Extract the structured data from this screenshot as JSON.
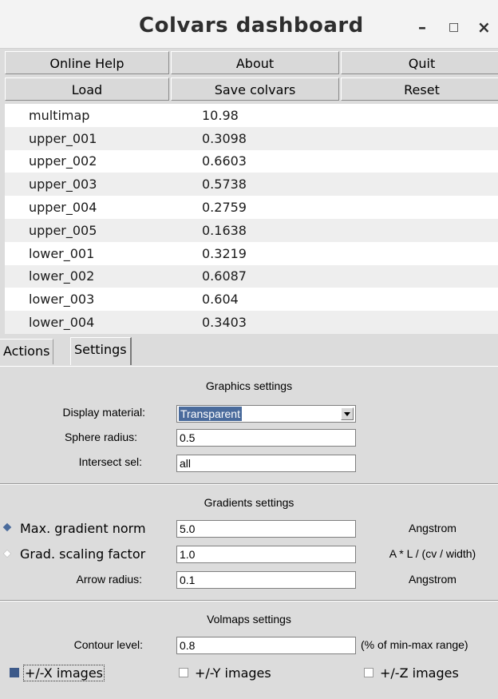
{
  "window": {
    "title": "Colvars dashboard",
    "minimize": "–",
    "maximize": "□",
    "close": "×"
  },
  "buttons": {
    "row1": [
      "Online Help",
      "About",
      "Quit"
    ],
    "row2": [
      "Load",
      "Save colvars",
      "Reset"
    ]
  },
  "colvars": [
    {
      "name": "multimap",
      "value": "10.98"
    },
    {
      "name": "upper_001",
      "value": "0.3098"
    },
    {
      "name": "upper_002",
      "value": "0.6603"
    },
    {
      "name": "upper_003",
      "value": "0.5738"
    },
    {
      "name": "upper_004",
      "value": "0.2759"
    },
    {
      "name": "upper_005",
      "value": "0.1638"
    },
    {
      "name": "lower_001",
      "value": "0.3219"
    },
    {
      "name": "lower_002",
      "value": "0.6087"
    },
    {
      "name": "lower_003",
      "value": "0.604"
    },
    {
      "name": "lower_004",
      "value": "0.3403"
    }
  ],
  "tabs": {
    "actions": "Actions",
    "settings": "Settings",
    "active": "Settings"
  },
  "graphics": {
    "title": "Graphics settings",
    "material_label": "Display material:",
    "material_value": "Transparent",
    "sphere_label": "Sphere radius:",
    "sphere_value": "0.5",
    "intersect_label": "Intersect sel:",
    "intersect_value": "all"
  },
  "gradients": {
    "title": "Gradients settings",
    "maxnorm_label": "Max. gradient norm",
    "maxnorm_value": "5.0",
    "maxnorm_unit": "Angstrom",
    "scaling_label": "Grad. scaling factor",
    "scaling_value": "1.0",
    "scaling_unit": "A * L / (cv / width)",
    "arrow_label": "Arrow radius:",
    "arrow_value": "0.1",
    "arrow_unit": "Angstrom",
    "selected_mode": "Max. gradient norm"
  },
  "volmaps": {
    "title": "Volmaps settings",
    "contour_label": "Contour level:",
    "contour_value": "0.8",
    "contour_unit": "(% of min-max range)",
    "x_label": "+/-X images",
    "x_checked": true,
    "y_label": "+/-Y images",
    "y_checked": false,
    "z_label": "+/-Z images",
    "z_checked": false
  },
  "colors": {
    "accent": "#4a6b9c",
    "background": "#dcdcdc"
  }
}
